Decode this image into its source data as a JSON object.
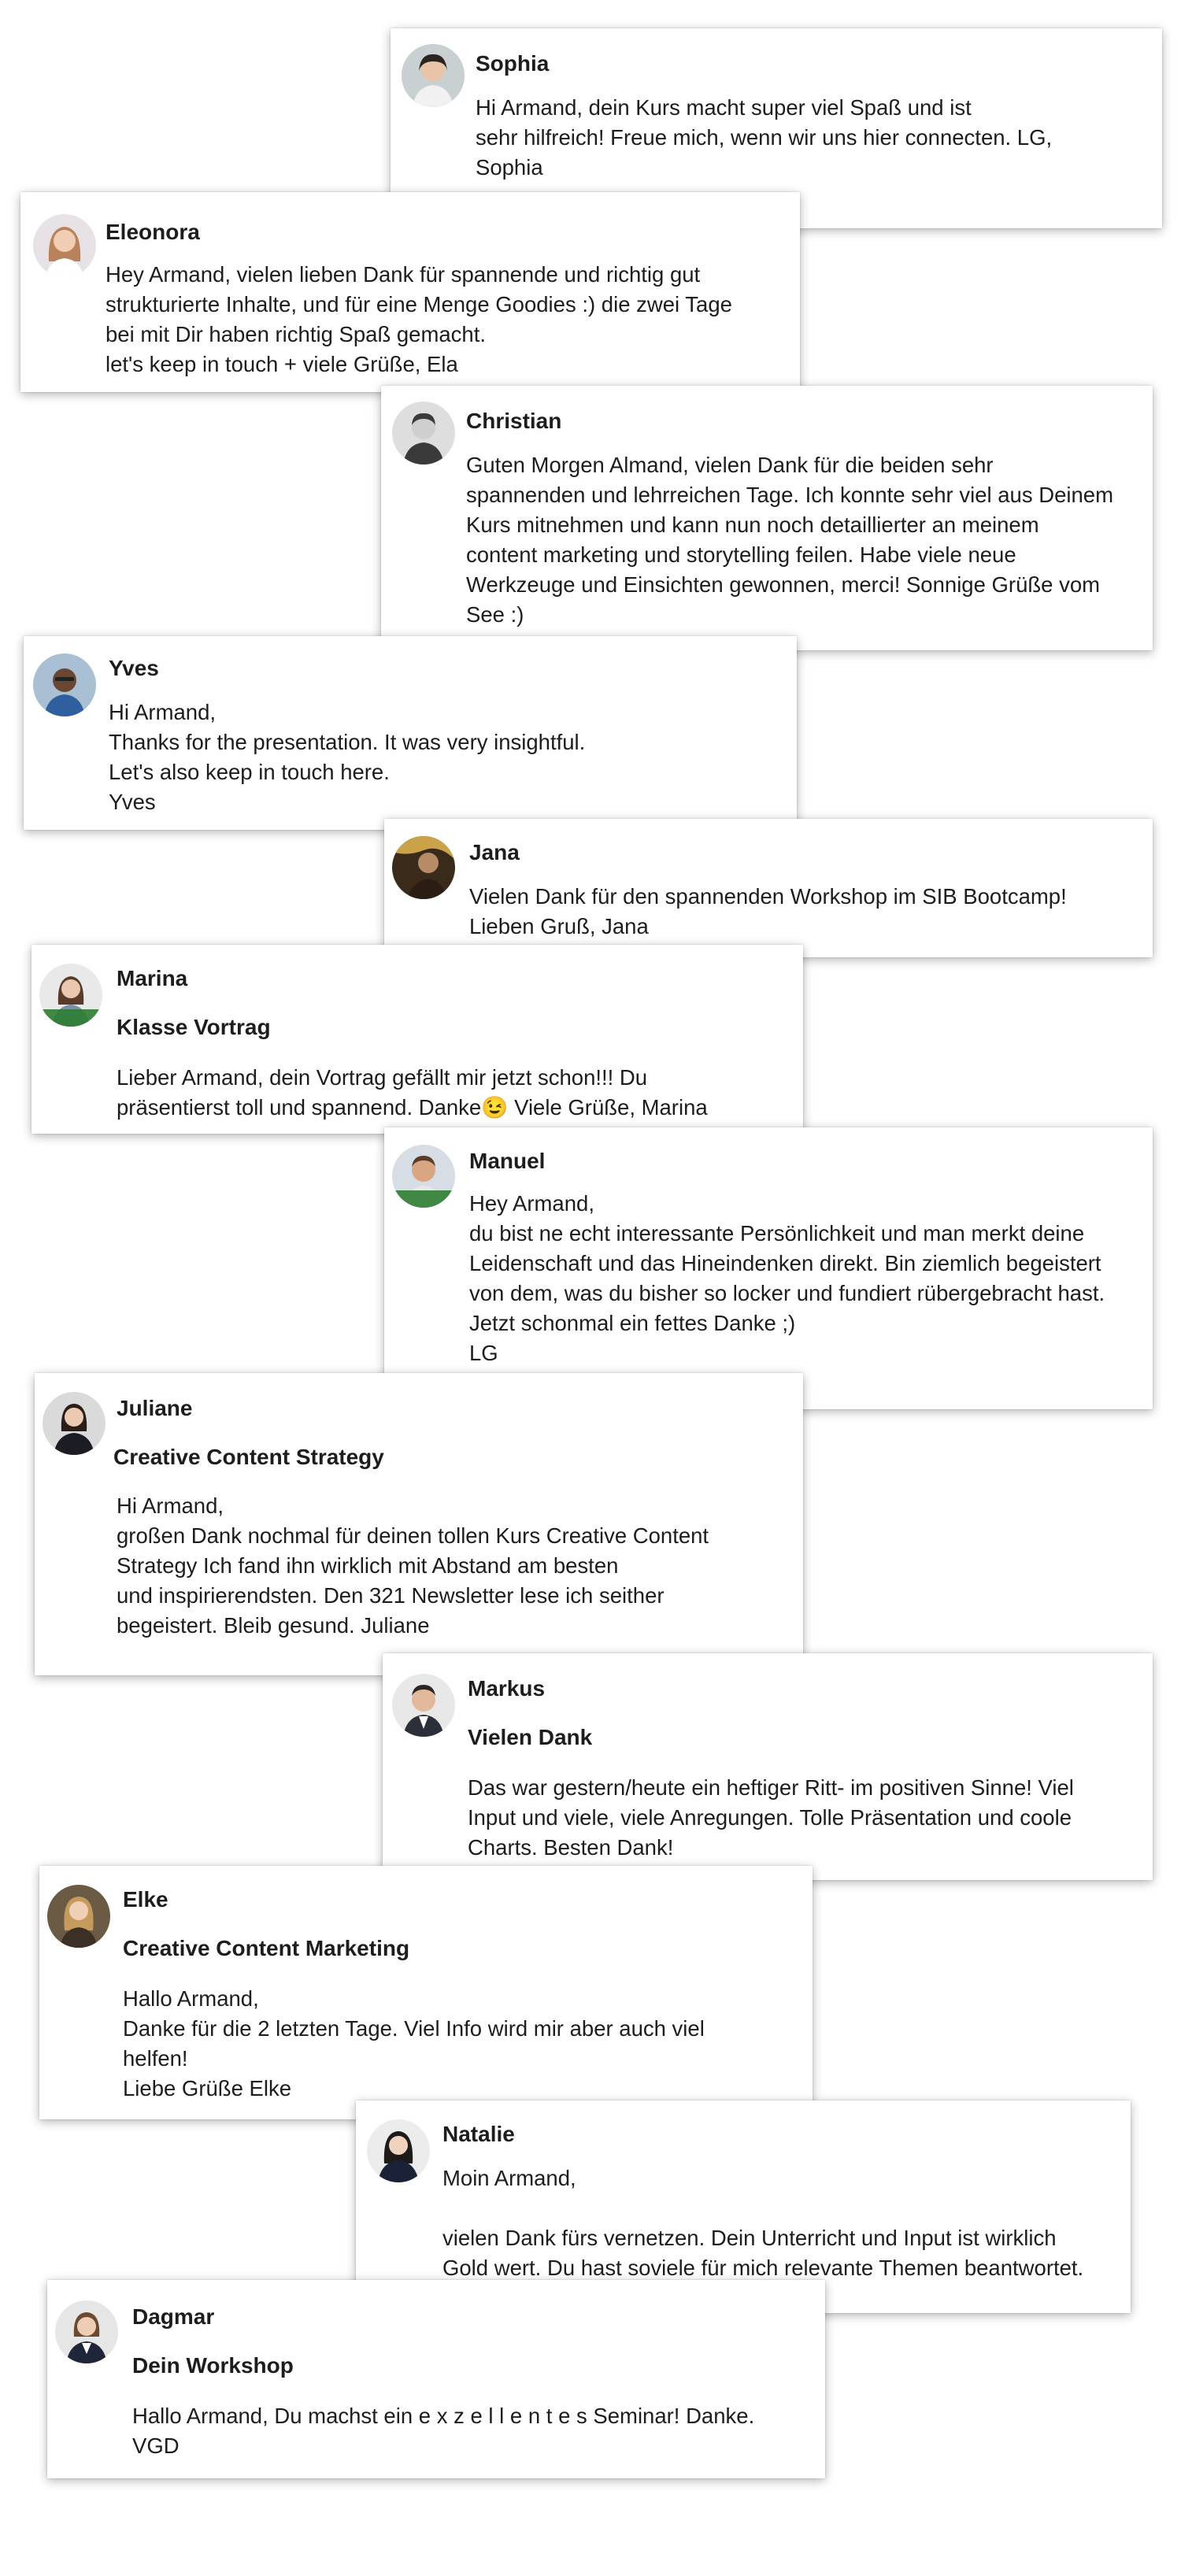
{
  "messages": [
    {
      "name": "Sophia",
      "subject": "",
      "text": "Hi Armand, dein Kurs macht super viel Spaß und ist\nsehr hilfreich! Freue mich, wenn wir uns hier connecten. LG,\nSophia",
      "avatar": "portrait-avatar"
    },
    {
      "name": "Eleonora",
      "subject": "",
      "text": "Hey Armand, vielen lieben Dank für spannende und richtig gut\nstrukturierte Inhalte, und für eine Menge Goodies :) die zwei Tage\nbei mit Dir haben richtig Spaß gemacht.\nlet's keep in touch + viele Grüße, Ela",
      "avatar": "portrait-avatar"
    },
    {
      "name": "Christian",
      "subject": "",
      "text": "Guten Morgen Almand, vielen Dank für die beiden sehr\nspannenden und lehrreichen Tage. Ich konnte sehr viel aus Deinem\nKurs mitnehmen und kann nun noch detaillierter an meinem\ncontent marketing und storytelling feilen. Habe viele neue\nWerkzeuge und Einsichten gewonnen, merci! Sonnige Grüße vom\nSee :)",
      "avatar": "portrait-avatar"
    },
    {
      "name": "Yves",
      "subject": "",
      "text": "Hi Armand,\nThanks for the presentation. It was very insightful.\nLet's also keep in touch here.\nYves",
      "avatar": "portrait-avatar"
    },
    {
      "name": "Jana",
      "subject": "",
      "text": "Vielen Dank für den spannenden Workshop im SIB Bootcamp!\nLieben Gruß, Jana",
      "avatar": "portrait-avatar"
    },
    {
      "name": "Marina",
      "subject": "Klasse Vortrag",
      "text": "Lieber Armand, dein Vortrag gefällt mir jetzt schon!!! Du\npräsentierst toll und spannend. Danke😉 Viele Grüße, Marina",
      "avatar": "portrait-avatar"
    },
    {
      "name": "Manuel",
      "subject": "",
      "text": "Hey Armand,\ndu bist ne echt interessante Persönlichkeit und man merkt deine\nLeidenschaft und das Hineindenken direkt. Bin ziemlich begeistert\nvon dem, was du bisher so locker und fundiert rübergebracht hast.\nJetzt schonmal ein fettes Danke ;)\nLG\nManu",
      "avatar": "portrait-avatar"
    },
    {
      "name": "Juliane",
      "subject": "Creative Content Strategy",
      "text": "Hi Armand,\ngroßen Dank nochmal für deinen tollen Kurs Creative Content\nStrategy Ich fand ihn wirklich mit Abstand am besten\nund inspirierendsten. Den 321 Newsletter lese ich seither\nbegeistert. Bleib gesund. Juliane",
      "avatar": "portrait-avatar"
    },
    {
      "name": "Markus",
      "subject": "Vielen Dank",
      "text": "Das war gestern/heute ein heftiger Ritt- im positiven Sinne! Viel\nInput und viele, viele Anregungen. Tolle Präsentation und coole\nCharts. Besten Dank!",
      "avatar": "portrait-avatar"
    },
    {
      "name": "Elke",
      "subject": "Creative Content Marketing",
      "text": "Hallo Armand,\nDanke für die 2 letzten Tage. Viel Info wird mir aber auch viel\nhelfen!\nLiebe Grüße Elke",
      "avatar": "portrait-avatar"
    },
    {
      "name": "Natalie",
      "subject": "",
      "text": "Moin Armand,\n\nvielen Dank fürs vernetzen. Dein Unterricht und Input ist wirklich\nGold wert. Du hast soviele für mich relevante Themen beantwortet.",
      "avatar": "portrait-avatar"
    },
    {
      "name": "Dagmar",
      "subject": "Dein Workshop",
      "text": "Hallo Armand, Du machst ein e x z e l l e n t e s Seminar! Danke.\nVGD",
      "avatar": "portrait-avatar"
    }
  ]
}
